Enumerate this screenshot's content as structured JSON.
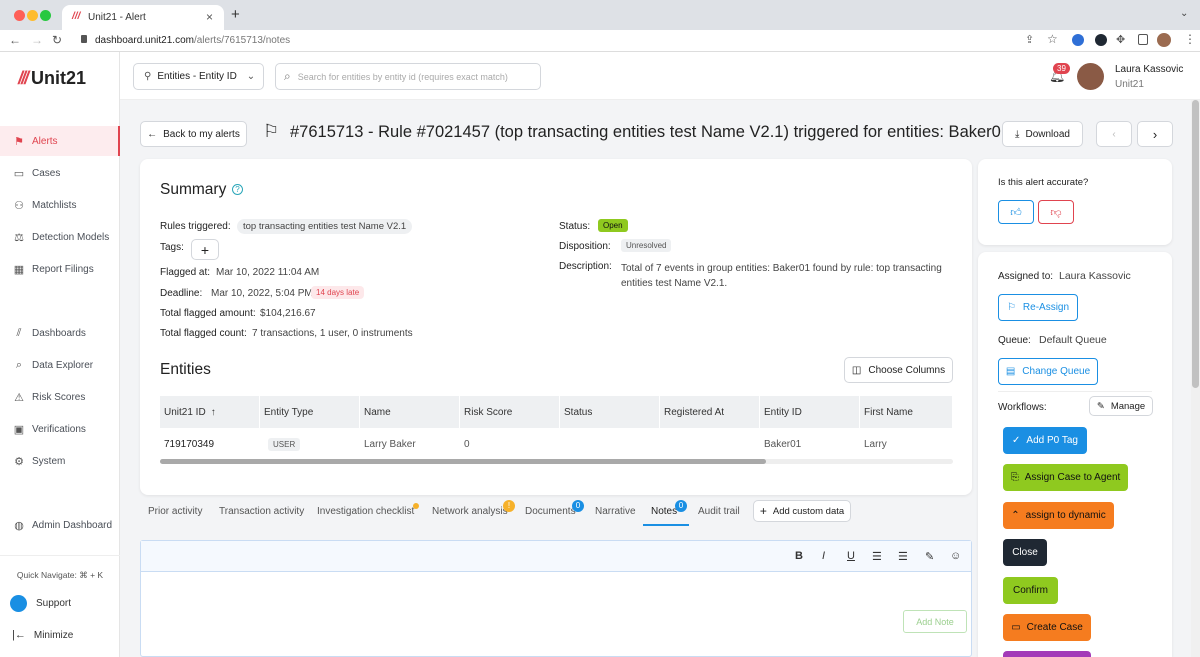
{
  "browser": {
    "tab_title": "Unit21 - Alert",
    "url_host": "dashboard.unit21.com",
    "url_path": "/alerts/7615713/notes"
  },
  "brand": {
    "name": "Unit21",
    "accent": "#e0444f",
    "blue": "#1a8fe3"
  },
  "sidebar": {
    "items": [
      {
        "label": "Alerts",
        "icon": "flag-icon"
      },
      {
        "label": "Cases",
        "icon": "briefcase-icon"
      },
      {
        "label": "Matchlists",
        "icon": "user-plus-icon"
      },
      {
        "label": "Detection Models",
        "icon": "scale-icon"
      },
      {
        "label": "Report Filings",
        "icon": "building-icon"
      },
      {
        "label": "Dashboards",
        "icon": "chart-icon"
      },
      {
        "label": "Data Explorer",
        "icon": "table-search-icon"
      },
      {
        "label": "Risk Scores",
        "icon": "warning-icon"
      },
      {
        "label": "Verifications",
        "icon": "id-card-icon"
      },
      {
        "label": "System",
        "icon": "gear-icon"
      },
      {
        "label": "Admin Dashboard",
        "icon": "globe-icon"
      }
    ],
    "quick_navigate": "Quick Navigate: ⌘ + K",
    "support": "Support",
    "minimize": "Minimize"
  },
  "topbar": {
    "entity_select": "Entities - Entity ID",
    "search_placeholder": "Search for entities by entity id (requires exact match)",
    "notif_count": "39",
    "user_name": "Laura Kassovic",
    "user_org": "Unit21"
  },
  "header": {
    "back": "Back to my alerts",
    "title": "#7615713 - Rule #7021457 (top transacting entities test Name V2.1) triggered for entities: Baker01",
    "download": "Download"
  },
  "summary": {
    "title": "Summary",
    "rules_label": "Rules triggered:",
    "rules_value": "top transacting entities test Name V2.1",
    "tags_label": "Tags:",
    "flagged_at_label": "Flagged at:",
    "flagged_at_value": "Mar 10, 2022 11:04 AM",
    "deadline_label": "Deadline:",
    "deadline_value": "Mar 10, 2022, 5:04 PM",
    "deadline_badge": "14 days late",
    "amount_label": "Total flagged amount:",
    "amount_value": "$104,216.67",
    "count_label": "Total flagged count:",
    "count_value": "7 transactions, 1 user, 0 instruments",
    "status_label": "Status:",
    "status_value": "Open",
    "disposition_label": "Disposition:",
    "disposition_value": "Unresolved",
    "description_label": "Description:",
    "description_value": "Total of 7 events in group entities: Baker01 found by rule: top transacting entities test Name V2.1."
  },
  "entities": {
    "title": "Entities",
    "choose_columns": "Choose Columns",
    "columns": [
      "Unit21 ID",
      "Entity Type",
      "Name",
      "Risk Score",
      "Status",
      "Registered At",
      "Entity ID",
      "First Name"
    ],
    "rows": [
      [
        "719170349",
        "USER",
        "Larry Baker",
        "0",
        "",
        "",
        "Baker01",
        "Larry"
      ]
    ]
  },
  "tabs": [
    {
      "label": "Prior activity"
    },
    {
      "label": "Transaction activity"
    },
    {
      "label": "Investigation checklist"
    },
    {
      "label": "Network analysis",
      "badge": "!"
    },
    {
      "label": "Documents",
      "badge": "0"
    },
    {
      "label": "Narrative"
    },
    {
      "label": "Notes",
      "badge": "0"
    },
    {
      "label": "Audit trail"
    }
  ],
  "add_custom_data": "Add custom data",
  "notes": {
    "add_note": "Add Note"
  },
  "accuracy": {
    "question": "Is this alert accurate?"
  },
  "assignment": {
    "assigned_label": "Assigned to:",
    "assigned_value": "Laura Kassovic",
    "reassign": "Re-Assign",
    "queue_label": "Queue:",
    "queue_value": "Default Queue",
    "change_queue": "Change Queue",
    "workflows_label": "Workflows:",
    "manage": "Manage"
  },
  "workflows": [
    {
      "label": "Add P0 Tag",
      "color": "#1a8fe3",
      "text": "#ffffff"
    },
    {
      "label": "Assign Case to Agent",
      "color": "#8fc91f",
      "text": "#111111"
    },
    {
      "label": "assign to dynamic",
      "color": "#f57c1f",
      "text": "#111111"
    },
    {
      "label": "Close",
      "color": "#1f2833",
      "text": "#ffffff"
    },
    {
      "label": "Confirm",
      "color": "#8fc91f",
      "text": "#111111"
    },
    {
      "label": "Create Case",
      "color": "#f57c1f",
      "text": "#111111"
    }
  ]
}
